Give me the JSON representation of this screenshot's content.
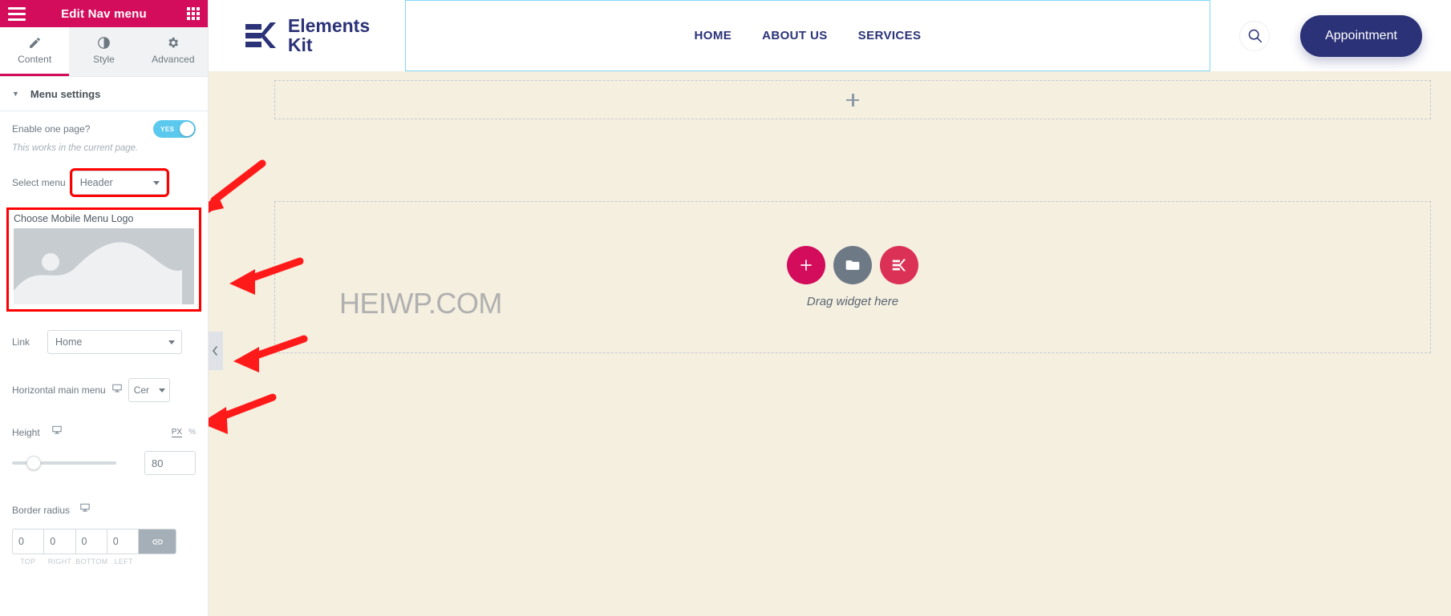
{
  "panel": {
    "title": "Edit Nav menu",
    "menu_icon": "hamburger-icon",
    "grid_icon": "grid-apps-icon",
    "tabs": [
      {
        "label": "Content",
        "icon": "pencil-icon",
        "active": true
      },
      {
        "label": "Style",
        "icon": "contrast-icon",
        "active": false
      },
      {
        "label": "Advanced",
        "icon": "gear-icon",
        "active": false
      }
    ],
    "section": {
      "title": "Menu settings",
      "caret": "▼"
    },
    "controls": {
      "enable_one_page": {
        "label": "Enable one page?",
        "toggle_text": "YES",
        "value": true
      },
      "note": "This works in the current page.",
      "select_menu": {
        "label": "Select menu",
        "value": "Header"
      },
      "mobile_logo": {
        "label": "Choose Mobile Menu Logo"
      },
      "link": {
        "label": "Link",
        "value": "Home"
      },
      "horizontal_main_menu": {
        "label": "Horizontal main menu",
        "value": "Cer"
      },
      "height": {
        "label": "Height",
        "value": "80",
        "units": [
          "PX",
          "%"
        ],
        "active_unit": "PX"
      },
      "border_radius": {
        "label": "Border radius",
        "values": [
          "0",
          "0",
          "0",
          "0"
        ],
        "sides": [
          "TOP",
          "RIGHT",
          "BOTTOM",
          "LEFT"
        ],
        "link_icon": "link-chain-icon"
      }
    }
  },
  "canvas": {
    "site_header": {
      "brand": {
        "line1": "Elements",
        "line2": "Kit",
        "logo_icon": "elementskit-logo-icon"
      },
      "nav": [
        "HOME",
        "ABOUT US",
        "SERVICES"
      ],
      "search_icon": "magnifier-icon",
      "appointment_button": "Appointment"
    },
    "add_section": {
      "icon": "plus-icon"
    },
    "dropzone": {
      "text": "Drag widget here",
      "buttons": [
        {
          "name": "add-widget-button",
          "icon": "plus-icon",
          "color": "#d30c5c"
        },
        {
          "name": "templates-button",
          "icon": "folder-icon",
          "color": "#6d7a86"
        },
        {
          "name": "elementskit-button",
          "icon": "elementskit-icon",
          "color": "#db3157"
        }
      ]
    },
    "watermark": "HEIWP.COM",
    "collapse_handle": {
      "icon": "chevron-left-icon"
    }
  },
  "colors": {
    "brand_pink": "#d30c5c",
    "navy": "#2b3277",
    "toggle_blue": "#5bc8ee",
    "canvas_bg": "#f5efe0",
    "highlight_red": "#ff0000"
  }
}
